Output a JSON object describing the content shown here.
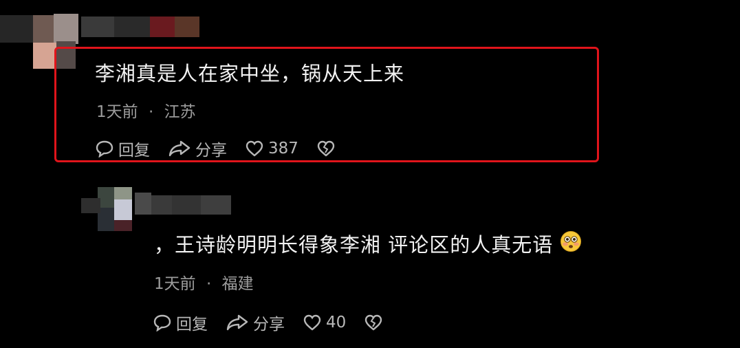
{
  "comments": [
    {
      "text": "李湘真是人在家中坐，锅从天上来",
      "time": "1天前",
      "separator": "·",
      "location": "江苏",
      "reply_label": "回复",
      "share_label": "分享",
      "likes": "387"
    },
    {
      "text": "，王诗龄明明长得象李湘 评论区的人真无语",
      "time": "1天前",
      "separator": "·",
      "location": "福建",
      "reply_label": "回复",
      "share_label": "分享",
      "likes": "40"
    }
  ],
  "colors": {
    "background": "#000000",
    "highlight_border": "#e0141b",
    "meta_text": "#9c9c9c"
  },
  "icons": [
    "reply-icon",
    "share-icon",
    "like-heart-icon",
    "dislike-broken-heart-icon",
    "flushed-face-emoji-icon"
  ]
}
